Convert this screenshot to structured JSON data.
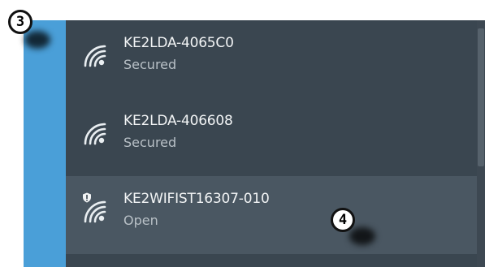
{
  "networks": [
    {
      "ssid": "KE2LDA-4065C0",
      "status": "Secured",
      "icon": "wifi-signal-icon"
    },
    {
      "ssid": "KE2LDA-406608",
      "status": "Secured",
      "icon": "wifi-signal-icon"
    },
    {
      "ssid": "KE2WIFIST16307-010",
      "status": "Open",
      "icon": "wifi-open-warning-icon",
      "highlighted": true
    }
  ],
  "callouts": {
    "step_3": "3",
    "step_4": "4"
  },
  "colors": {
    "accent": "#4a9fd8",
    "panel_bg": "#3a4650",
    "highlight_bg": "#4a5762",
    "text_primary": "#f2f4f5",
    "text_secondary": "#b8c0c6"
  }
}
